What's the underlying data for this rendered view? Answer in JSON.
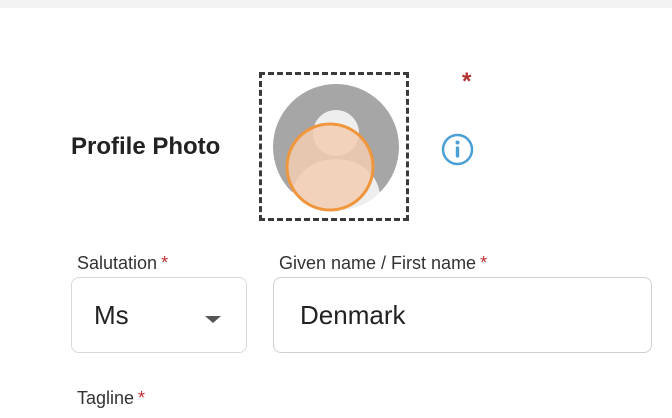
{
  "profile_photo": {
    "label": "Profile Photo",
    "required_marker": "*",
    "info_icon": "info-circle-icon",
    "avatar_icon": "person-avatar-icon"
  },
  "salutation": {
    "label": "Salutation",
    "required_marker": "*",
    "value": "Ms",
    "dropdown_icon": "caret-down-icon"
  },
  "given_name": {
    "label": "Given name / First name",
    "required_marker": "*",
    "value": "Denmark"
  },
  "tagline": {
    "label": "Tagline",
    "required_marker": "*"
  },
  "colors": {
    "required": "#c03030",
    "info": "#4a9fd5",
    "highlight_ring": "#f0963c",
    "avatar_gray": "#a6a6a6"
  }
}
